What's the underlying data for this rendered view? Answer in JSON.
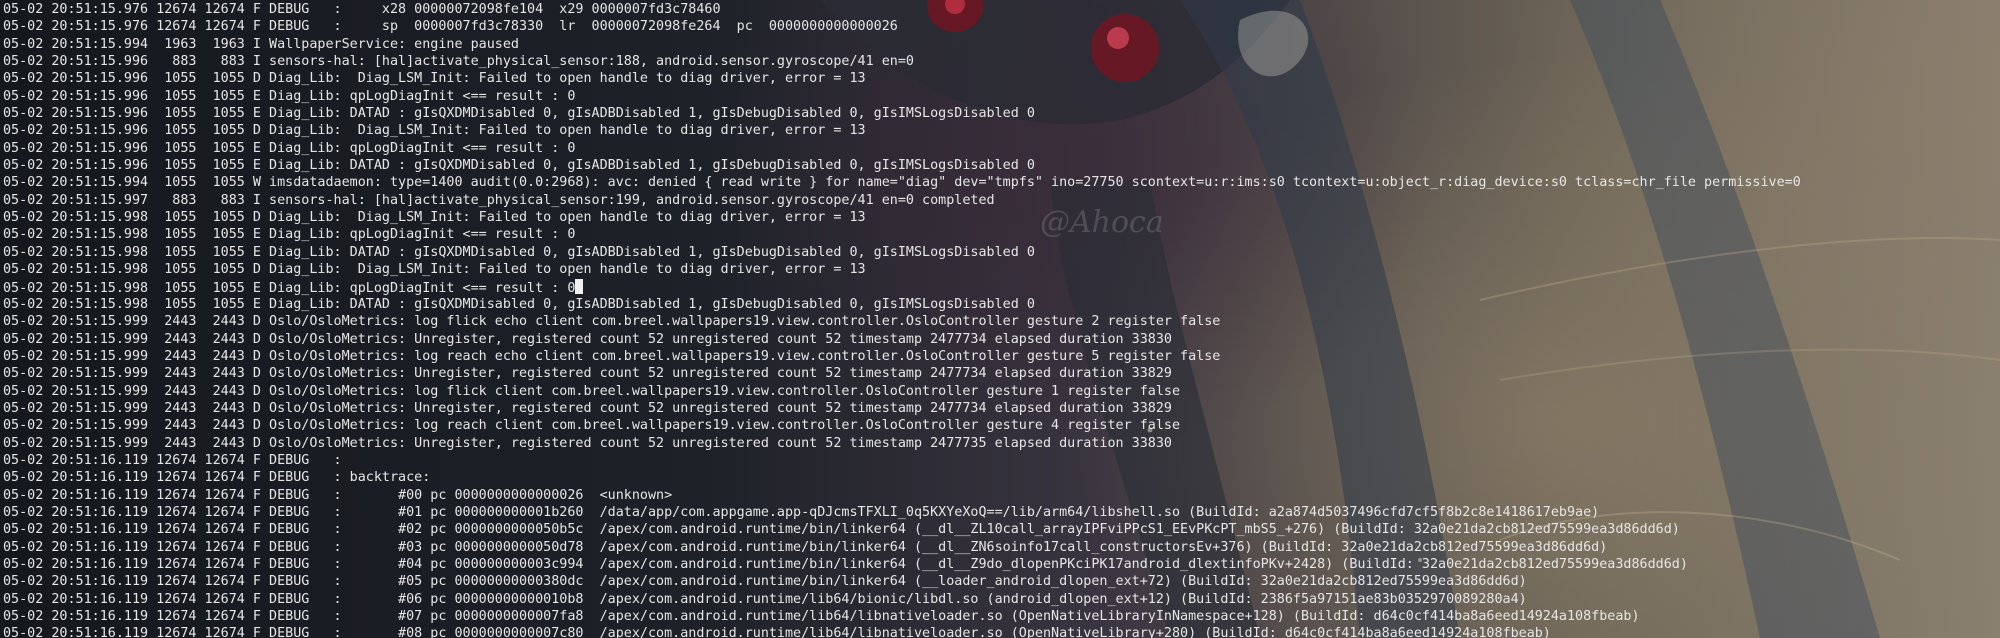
{
  "terminal": {
    "lines": [
      "05-02 20:51:15.976 12674 12674 F DEBUG   :     x28 00000072098fe104  x29 0000007fd3c78460",
      "05-02 20:51:15.976 12674 12674 F DEBUG   :     sp  0000007fd3c78330  lr  00000072098fe264  pc  0000000000000026",
      "05-02 20:51:15.994  1963  1963 I WallpaperService: engine paused",
      "05-02 20:51:15.996   883   883 I sensors-hal: [hal]activate_physical_sensor:188, android.sensor.gyroscope/41 en=0",
      "05-02 20:51:15.996  1055  1055 D Diag_Lib:  Diag_LSM_Init: Failed to open handle to diag driver, error = 13",
      "05-02 20:51:15.996  1055  1055 E Diag_Lib: qpLogDiagInit <== result : 0",
      "05-02 20:51:15.996  1055  1055 E Diag_Lib: DATAD : gIsQXDMDisabled 0, gIsADBDisabled 1, gIsDebugDisabled 0, gIsIMSLogsDisabled 0",
      "05-02 20:51:15.996  1055  1055 D Diag_Lib:  Diag_LSM_Init: Failed to open handle to diag driver, error = 13",
      "05-02 20:51:15.996  1055  1055 E Diag_Lib: qpLogDiagInit <== result : 0",
      "05-02 20:51:15.996  1055  1055 E Diag_Lib: DATAD : gIsQXDMDisabled 0, gIsADBDisabled 1, gIsDebugDisabled 0, gIsIMSLogsDisabled 0",
      "05-02 20:51:15.994  1055  1055 W imsdatadaemon: type=1400 audit(0.0:2968): avc: denied { read write } for name=\"diag\" dev=\"tmpfs\" ino=27750 scontext=u:r:ims:s0 tcontext=u:object_r:diag_device:s0 tclass=chr_file permissive=0",
      "05-02 20:51:15.997   883   883 I sensors-hal: [hal]activate_physical_sensor:199, android.sensor.gyroscope/41 en=0 completed",
      "05-02 20:51:15.998  1055  1055 D Diag_Lib:  Diag_LSM_Init: Failed to open handle to diag driver, error = 13",
      "05-02 20:51:15.998  1055  1055 E Diag_Lib: qpLogDiagInit <== result : 0",
      "05-02 20:51:15.998  1055  1055 E Diag_Lib: DATAD : gIsQXDMDisabled 0, gIsADBDisabled 1, gIsDebugDisabled 0, gIsIMSLogsDisabled 0",
      "05-02 20:51:15.998  1055  1055 D Diag_Lib:  Diag_LSM_Init: Failed to open handle to diag driver, error = 13",
      "05-02 20:51:15.998  1055  1055 E Diag_Lib: qpLogDiagInit <== result : 0",
      "05-02 20:51:15.998  1055  1055 E Diag_Lib: DATAD : gIsQXDMDisabled 0, gIsADBDisabled 1, gIsDebugDisabled 0, gIsIMSLogsDisabled 0",
      "05-02 20:51:15.999  2443  2443 D Oslo/OsloMetrics: log flick echo client com.breel.wallpapers19.view.controller.OsloController gesture 2 register false",
      "05-02 20:51:15.999  2443  2443 D Oslo/OsloMetrics: Unregister, registered count 52 unregistered count 52 timestamp 2477734 elapsed duration 33830",
      "05-02 20:51:15.999  2443  2443 D Oslo/OsloMetrics: log reach echo client com.breel.wallpapers19.view.controller.OsloController gesture 5 register false",
      "05-02 20:51:15.999  2443  2443 D Oslo/OsloMetrics: Unregister, registered count 52 unregistered count 52 timestamp 2477734 elapsed duration 33829",
      "05-02 20:51:15.999  2443  2443 D Oslo/OsloMetrics: log flick client com.breel.wallpapers19.view.controller.OsloController gesture 1 register false",
      "05-02 20:51:15.999  2443  2443 D Oslo/OsloMetrics: Unregister, registered count 52 unregistered count 52 timestamp 2477734 elapsed duration 33829",
      "05-02 20:51:15.999  2443  2443 D Oslo/OsloMetrics: log reach client com.breel.wallpapers19.view.controller.OsloController gesture 4 register false",
      "05-02 20:51:15.999  2443  2443 D Oslo/OsloMetrics: Unregister, registered count 52 unregistered count 52 timestamp 2477735 elapsed duration 33830",
      "05-02 20:51:16.119 12674 12674 F DEBUG   :",
      "05-02 20:51:16.119 12674 12674 F DEBUG   : backtrace:",
      "05-02 20:51:16.119 12674 12674 F DEBUG   :       #00 pc 0000000000000026  <unknown>",
      "05-02 20:51:16.119 12674 12674 F DEBUG   :       #01 pc 000000000001b260  /data/app/com.appgame.app-qDJcmsTFXLI_0q5KXYeXoQ==/lib/arm64/libshell.so (BuildId: a2a874d5037496cfd7cf5f8b2c8e1418617eb9ae)",
      "05-02 20:51:16.119 12674 12674 F DEBUG   :       #02 pc 0000000000050b5c  /apex/com.android.runtime/bin/linker64 (__dl__ZL10call_arrayIPFviPPcS1_EEvPKcPT_mbS5_+276) (BuildId: 32a0e21da2cb812ed75599ea3d86dd6d)",
      "05-02 20:51:16.119 12674 12674 F DEBUG   :       #03 pc 0000000000050d78  /apex/com.android.runtime/bin/linker64 (__dl__ZN6soinfo17call_constructorsEv+376) (BuildId: 32a0e21da2cb812ed75599ea3d86dd6d)",
      "05-02 20:51:16.119 12674 12674 F DEBUG   :       #04 pc 000000000003c994  /apex/com.android.runtime/bin/linker64 (__dl__Z9do_dlopenPKciPK17android_dlextinfoPKv+2428) (BuildId: 32a0e21da2cb812ed75599ea3d86dd6d)",
      "05-02 20:51:16.119 12674 12674 F DEBUG   :       #05 pc 00000000000380dc  /apex/com.android.runtime/bin/linker64 (__loader_android_dlopen_ext+72) (BuildId: 32a0e21da2cb812ed75599ea3d86dd6d)",
      "05-02 20:51:16.119 12674 12674 F DEBUG   :       #06 pc 00000000000010b8  /apex/com.android.runtime/lib64/bionic/libdl.so (android_dlopen_ext+12) (BuildId: 2386f5a97151ae83b0352970089280a4)",
      "05-02 20:51:16.119 12674 12674 F DEBUG   :       #07 pc 0000000000007fa8  /apex/com.android.runtime/lib64/libnativeloader.so (OpenNativeLibraryInNamespace+128) (BuildId: d64c0cf414ba8a6eed14924a108fbeab)",
      "05-02 20:51:16.119 12674 12674 F DEBUG   :       #08 pc 0000000000007c80  /apex/com.android.runtime/lib64/libnativeloader.so (OpenNativeLibrary+280) (BuildId: d64c0cf414ba8a6eed14924a108fbeab)"
    ],
    "cursor_line_index": 16,
    "watermark": "@Ahoca"
  }
}
